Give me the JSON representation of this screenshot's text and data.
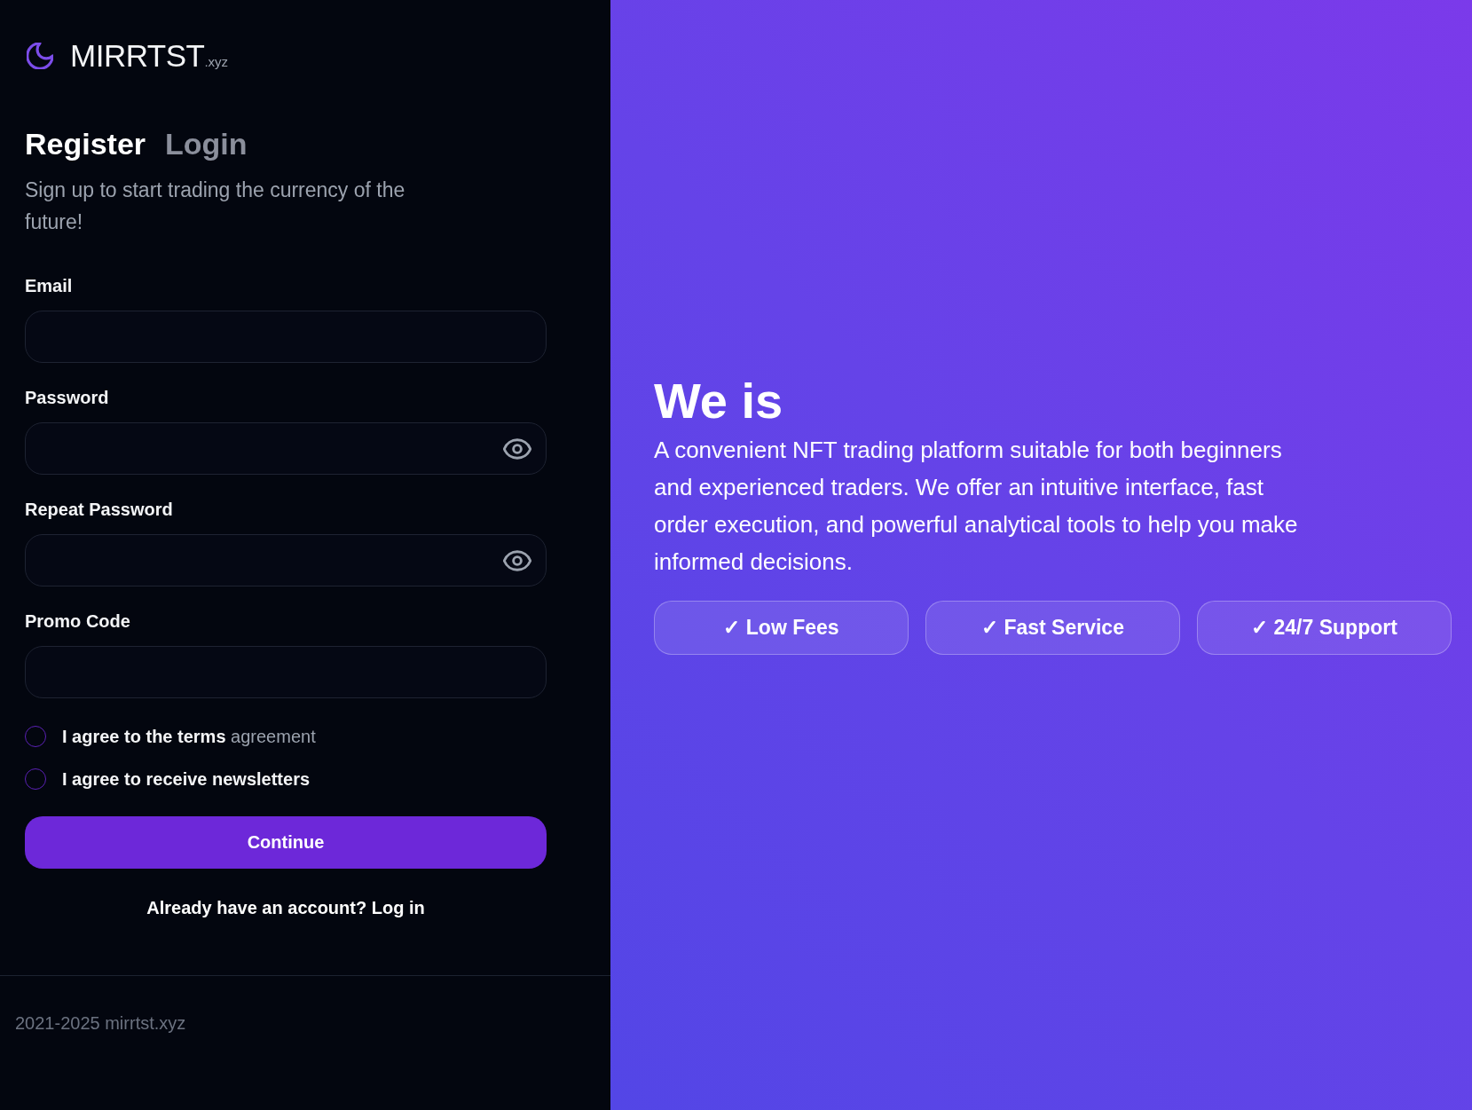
{
  "brand": {
    "name": "MIRRTST",
    "suffix": ".xyz"
  },
  "tabs": [
    {
      "label": "Register",
      "selected": true
    },
    {
      "label": "Login",
      "selected": false
    }
  ],
  "subtitle": "Sign up to start trading the currency of the future!",
  "fields": [
    {
      "label": "Email",
      "kind": "text"
    },
    {
      "label": "Password",
      "kind": "password"
    },
    {
      "label": "Repeat Password",
      "kind": "password"
    },
    {
      "label": "Promo Code",
      "kind": "text"
    }
  ],
  "checkboxes": [
    {
      "label": "I agree to the terms",
      "link": "agreement",
      "checked": false
    },
    {
      "label": "I agree to receive newsletters",
      "checked": false
    }
  ],
  "submit_button": "Continue",
  "login_prompt": "Already have an account? Log in",
  "footer": {
    "copyright": "2021-2025 mirrtst.xyz"
  },
  "hero": {
    "title": "We is",
    "description": "A convenient NFT trading platform suitable for both beginners and experienced traders. We offer an intuitive interface, fast order execution, and powerful analytical tools to help you make informed decisions.",
    "features": [
      "✓ Low Fees",
      "✓ Fast Service",
      "✓ 24/7 Support"
    ]
  }
}
